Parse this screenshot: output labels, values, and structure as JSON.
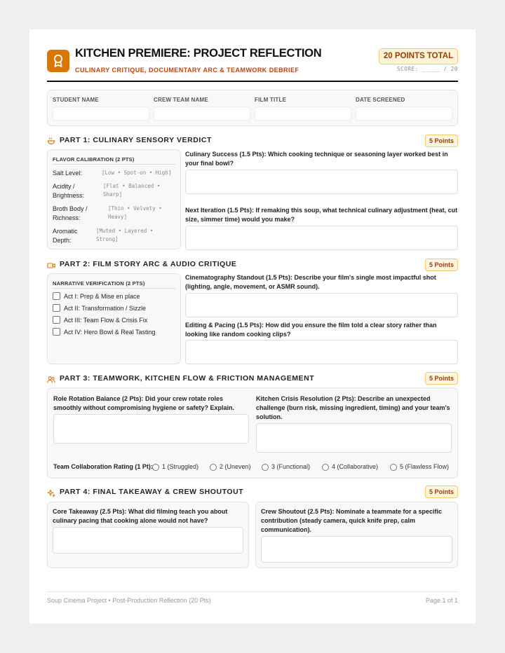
{
  "header": {
    "title": "KITCHEN PREMIERE: PROJECT REFLECTION",
    "subtitle": "CULINARY CRITIQUE, DOCUMENTARY ARC & TEAMWORK DEBRIEF",
    "points_total": "20 POINTS TOTAL",
    "score_line": "SCORE: _____ / 20",
    "logo_icon": "award-ribbon-icon",
    "accent_color": "#d97706"
  },
  "info_fields": [
    {
      "label": "STUDENT NAME",
      "value": ""
    },
    {
      "label": "CREW TEAM NAME",
      "value": ""
    },
    {
      "label": "FILM TITLE",
      "value": ""
    },
    {
      "label": "DATE SCREENED",
      "value": ""
    }
  ],
  "part1": {
    "title": "PART 1: CULINARY SENSORY VERDICT",
    "points": "5 Points",
    "icon": "soup-bowl-icon",
    "flavor_head": "FLAVOR CALIBRATION (2 PTS)",
    "flavor_rows": [
      {
        "label": "Salt Level:",
        "options": "[Low • Spot-on • High]"
      },
      {
        "label": "Acidity /\nBrightness:",
        "options": "[Flat • Balanced •\nSharp]"
      },
      {
        "label": "Broth Body /\nRichness:",
        "options": "[Thin • Velvety •\nHeavy]"
      },
      {
        "label": "Aromatic\nDepth:",
        "options": "[Muted • Layered •\nStrong]"
      }
    ],
    "q1": "Culinary Success (1.5 Pts): Which cooking technique or seasoning layer worked best in your final bowl?",
    "q1_answer": "",
    "q2": "Next Iteration (1.5 Pts): If remaking this soup, what technical culinary adjustment (heat, cut size, simmer time) would you make?",
    "q2_answer": ""
  },
  "part2": {
    "title": "PART 2: FILM STORY ARC & AUDIO CRITIQUE",
    "points": "5 Points",
    "icon": "video-camera-icon",
    "narrative_head": "NARRATIVE VERIFICATION (2 PTS)",
    "checklist": [
      {
        "label": "Act I: Prep & Mise en place",
        "checked": false
      },
      {
        "label": "Act II: Transformation / Sizzle",
        "checked": false
      },
      {
        "label": "Act III: Team Flow & Crisis Fix",
        "checked": false
      },
      {
        "label": "Act IV: Hero Bowl & Real Tasting",
        "checked": false
      }
    ],
    "q1": "Cinematography Standout (1.5 Pts): Describe your film's single most impactful shot (lighting, angle, movement, or ASMR sound).",
    "q1_answer": "",
    "q2": "Editing & Pacing (1.5 Pts): How did you ensure the film told a clear story rather than looking like random cooking clips?",
    "q2_answer": ""
  },
  "part3": {
    "title": "PART 3: TEAMWORK, KITCHEN FLOW & FRICTION MANAGEMENT",
    "points": "5 Points",
    "icon": "team-users-icon",
    "q1": "Role Rotation Balance (2 Pts): Did your crew rotate roles smoothly without compromising hygiene or safety? Explain.",
    "q1_answer": "",
    "q2": "Kitchen Crisis Resolution (2 Pts): Describe an unexpected challenge (burn risk, missing ingredient, timing) and your team's solution.",
    "q2_answer": "",
    "rating_label": "Team Collaboration Rating (1 Pt):",
    "rating_options": [
      "1 (Struggled)",
      "2 (Uneven)",
      "3 (Functional)",
      "4 (Collaborative)",
      "5 (Flawless Flow)"
    ],
    "rating_selected": null
  },
  "part4": {
    "title": "PART 4: FINAL TAKEAWAY & CREW SHOUTOUT",
    "points": "5 Points",
    "icon": "sparkle-icon",
    "q1": "Core Takeaway (2.5 Pts): What did filming teach you about culinary pacing that cooking alone would not have?",
    "q1_answer": "",
    "q2": "Crew Shoutout (2.5 Pts): Nominate a teammate for a specific contribution (steady camera, quick knife prep, calm communication).",
    "q2_answer": ""
  },
  "footer": {
    "left": "Soup Cinema Project • Post-Production Reflection (20 Pts)",
    "right": "Page 1 of 1"
  }
}
